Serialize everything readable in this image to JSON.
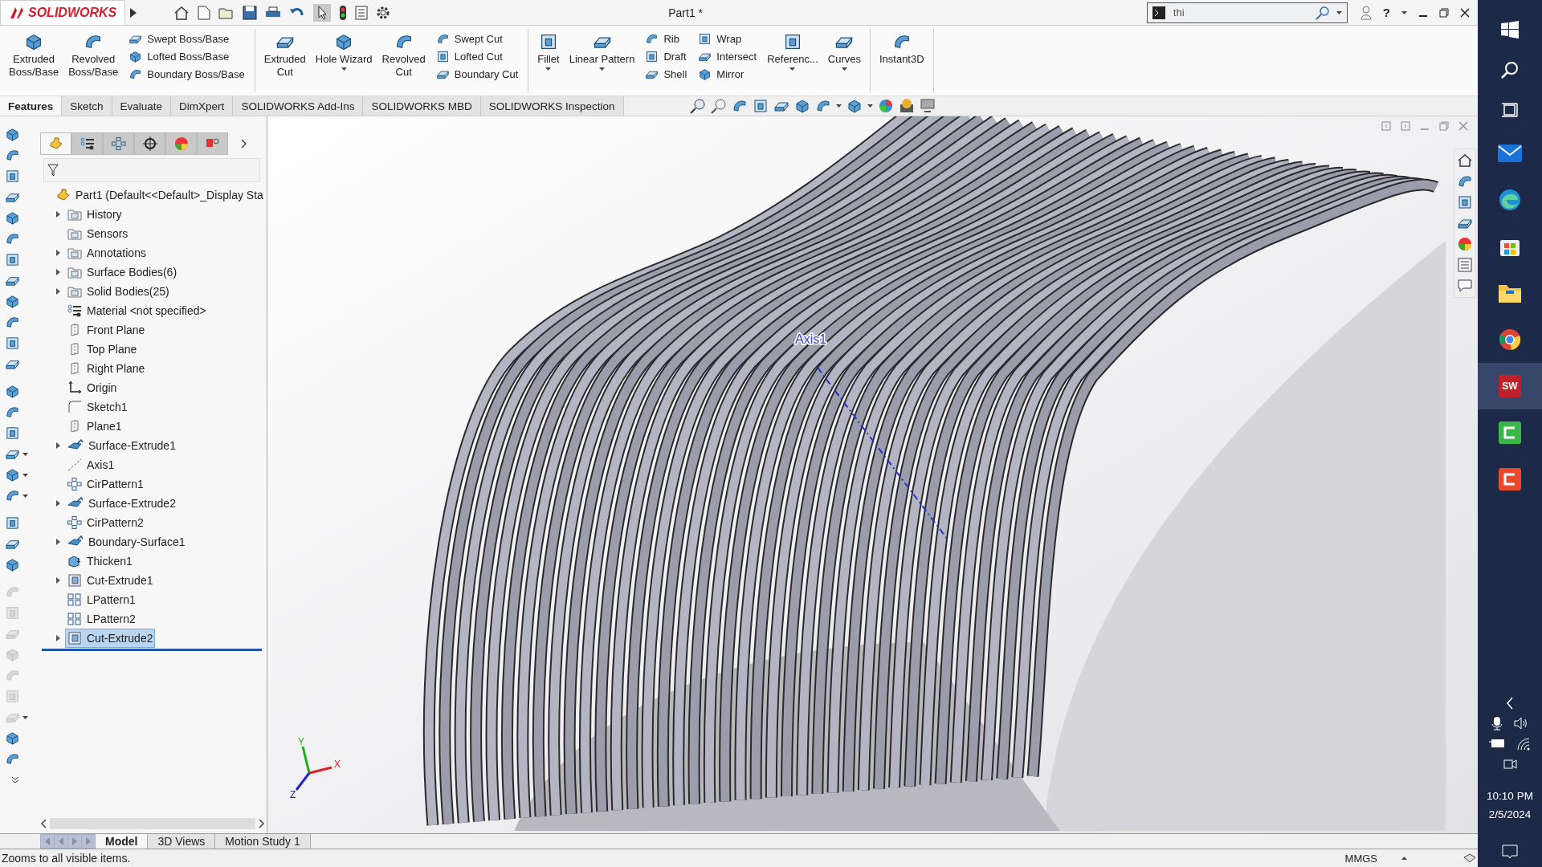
{
  "title_bar": {
    "app_name": "SOLIDWORKS",
    "document_title": "Part1 *",
    "search": {
      "value": "thi"
    },
    "help_label": "?"
  },
  "command_groups": [
    {
      "items": [
        {
          "kind": "large",
          "label": "Extruded\nBoss/Base",
          "dropdown": false
        },
        {
          "kind": "large",
          "label": "Revolved\nBoss/Base",
          "dropdown": false
        },
        {
          "kind": "stack",
          "entries": [
            "Swept Boss/Base",
            "Lofted Boss/Base",
            "Boundary Boss/Base"
          ]
        }
      ]
    },
    {
      "items": [
        {
          "kind": "large",
          "label": "Extruded\nCut",
          "dropdown": false
        },
        {
          "kind": "large",
          "label": "Hole Wizard",
          "dropdown": true
        },
        {
          "kind": "large",
          "label": "Revolved\nCut",
          "dropdown": false
        },
        {
          "kind": "stack",
          "entries": [
            "Swept Cut",
            "Lofted Cut",
            "Boundary Cut"
          ]
        }
      ]
    },
    {
      "items": [
        {
          "kind": "large",
          "label": "Fillet",
          "dropdown": true
        },
        {
          "kind": "large",
          "label": "Linear Pattern",
          "dropdown": true
        },
        {
          "kind": "stack",
          "entries": [
            "Rib",
            "Draft",
            "Shell"
          ]
        },
        {
          "kind": "stack",
          "entries": [
            "Wrap",
            "Intersect",
            "Mirror"
          ]
        },
        {
          "kind": "large",
          "label": "Referenc...",
          "dropdown": true
        },
        {
          "kind": "large",
          "label": "Curves",
          "dropdown": true
        }
      ]
    },
    {
      "items": [
        {
          "kind": "large",
          "label": "Instant3D",
          "dropdown": false
        }
      ]
    }
  ],
  "command_tabs": [
    {
      "label": "Features",
      "selected": true
    },
    {
      "label": "Sketch",
      "selected": false
    },
    {
      "label": "Evaluate",
      "selected": false
    },
    {
      "label": "DimXpert",
      "selected": false
    },
    {
      "label": "SOLIDWORKS Add-Ins",
      "selected": false
    },
    {
      "label": "SOLIDWORKS MBD",
      "selected": false
    },
    {
      "label": "SOLIDWORKS Inspection",
      "selected": false
    }
  ],
  "left_toolbar": [
    {
      "disabled": false,
      "dropdown": false
    },
    {
      "disabled": false,
      "dropdown": false
    },
    {
      "disabled": false,
      "dropdown": false
    },
    {
      "disabled": false,
      "dropdown": false
    },
    {
      "disabled": false,
      "dropdown": false
    },
    {
      "disabled": false,
      "dropdown": false
    },
    {
      "disabled": false,
      "dropdown": false
    },
    {
      "disabled": false,
      "dropdown": false
    },
    {
      "disabled": false,
      "dropdown": false
    },
    {
      "disabled": false,
      "dropdown": false
    },
    {
      "disabled": false,
      "dropdown": false
    },
    {
      "disabled": false,
      "dropdown": false
    },
    {
      "disabled": false,
      "dropdown": false
    },
    {
      "disabled": false,
      "dropdown": false
    },
    {
      "disabled": false,
      "dropdown": false
    },
    {
      "disabled": false,
      "dropdown": true
    },
    {
      "disabled": false,
      "dropdown": true
    },
    {
      "disabled": false,
      "dropdown": true
    },
    {
      "disabled": false,
      "dropdown": false
    },
    {
      "disabled": false,
      "dropdown": false
    },
    {
      "disabled": false,
      "dropdown": false
    },
    {
      "disabled": true,
      "dropdown": false
    },
    {
      "disabled": true,
      "dropdown": false
    },
    {
      "disabled": true,
      "dropdown": false
    },
    {
      "disabled": true,
      "dropdown": false
    },
    {
      "disabled": true,
      "dropdown": false
    },
    {
      "disabled": true,
      "dropdown": false
    },
    {
      "disabled": true,
      "dropdown": true
    },
    {
      "disabled": false,
      "dropdown": false
    },
    {
      "disabled": false,
      "dropdown": false
    }
  ],
  "feature_manager": {
    "panel_tabs": [
      {
        "selected": true
      },
      {
        "selected": false
      },
      {
        "selected": false
      },
      {
        "selected": false
      },
      {
        "selected": false
      },
      {
        "selected": false
      }
    ],
    "tree": {
      "label": "Part1  (Default<<Default>_Display Sta",
      "kind": "part",
      "children": [
        {
          "label": "History",
          "kind": "folder",
          "expandable": true,
          "selected": false
        },
        {
          "label": "Sensors",
          "kind": "folder",
          "expandable": false,
          "selected": false
        },
        {
          "label": "Annotations",
          "kind": "folder",
          "expandable": true,
          "selected": false
        },
        {
          "label": "Surface Bodies(6)",
          "kind": "folder",
          "expandable": true,
          "selected": false
        },
        {
          "label": "Solid Bodies(25)",
          "kind": "folder",
          "expandable": true,
          "selected": false
        },
        {
          "label": "Material <not specified>",
          "kind": "material",
          "expandable": false,
          "selected": false
        },
        {
          "label": "Front Plane",
          "kind": "plane",
          "expandable": false,
          "selected": false
        },
        {
          "label": "Top Plane",
          "kind": "plane",
          "expandable": false,
          "selected": false
        },
        {
          "label": "Right Plane",
          "kind": "plane",
          "expandable": false,
          "selected": false
        },
        {
          "label": "Origin",
          "kind": "origin",
          "expandable": false,
          "selected": false
        },
        {
          "label": "Sketch1",
          "kind": "sketch",
          "expandable": false,
          "selected": false
        },
        {
          "label": "Plane1",
          "kind": "plane",
          "expandable": false,
          "selected": false
        },
        {
          "label": "Surface-Extrude1",
          "kind": "surface",
          "expandable": true,
          "selected": false
        },
        {
          "label": "Axis1",
          "kind": "axis",
          "expandable": false,
          "selected": false
        },
        {
          "label": "CirPattern1",
          "kind": "pattern",
          "expandable": false,
          "selected": false
        },
        {
          "label": "Surface-Extrude2",
          "kind": "surface",
          "expandable": true,
          "selected": false
        },
        {
          "label": "CirPattern2",
          "kind": "pattern",
          "expandable": false,
          "selected": false
        },
        {
          "label": "Boundary-Surface1",
          "kind": "surface",
          "expandable": true,
          "selected": false
        },
        {
          "label": "Thicken1",
          "kind": "solid",
          "expandable": false,
          "selected": false
        },
        {
          "label": "Cut-Extrude1",
          "kind": "cut",
          "expandable": true,
          "selected": false
        },
        {
          "label": "LPattern1",
          "kind": "lpattern",
          "expandable": false,
          "selected": false
        },
        {
          "label": "LPattern2",
          "kind": "lpattern",
          "expandable": false,
          "selected": false
        },
        {
          "label": "Cut-Extrude2",
          "kind": "cut",
          "expandable": true,
          "selected": true
        }
      ]
    }
  },
  "axis_label": "Axis1",
  "triad": {
    "x": "X",
    "y": "Y",
    "z": "Z"
  },
  "bottom_tabs": [
    {
      "label": "Model",
      "selected": true
    },
    {
      "label": "3D Views",
      "selected": false
    },
    {
      "label": "Motion Study 1",
      "selected": false
    }
  ],
  "status_bar": {
    "message": "Zooms to all visible items.",
    "units": "MMGS"
  },
  "taskbar": {
    "time": "10:10 PM",
    "date": "2/5/2024",
    "apps": [
      {
        "kind": "mail",
        "selected": false
      },
      {
        "kind": "edge",
        "selected": false
      },
      {
        "kind": "store",
        "selected": false
      },
      {
        "kind": "explorer",
        "selected": false
      },
      {
        "kind": "chrome",
        "selected": false
      },
      {
        "kind": "solidworks",
        "label": "SW",
        "selected": true
      },
      {
        "kind": "green",
        "selected": false
      },
      {
        "kind": "red",
        "selected": false
      }
    ]
  }
}
